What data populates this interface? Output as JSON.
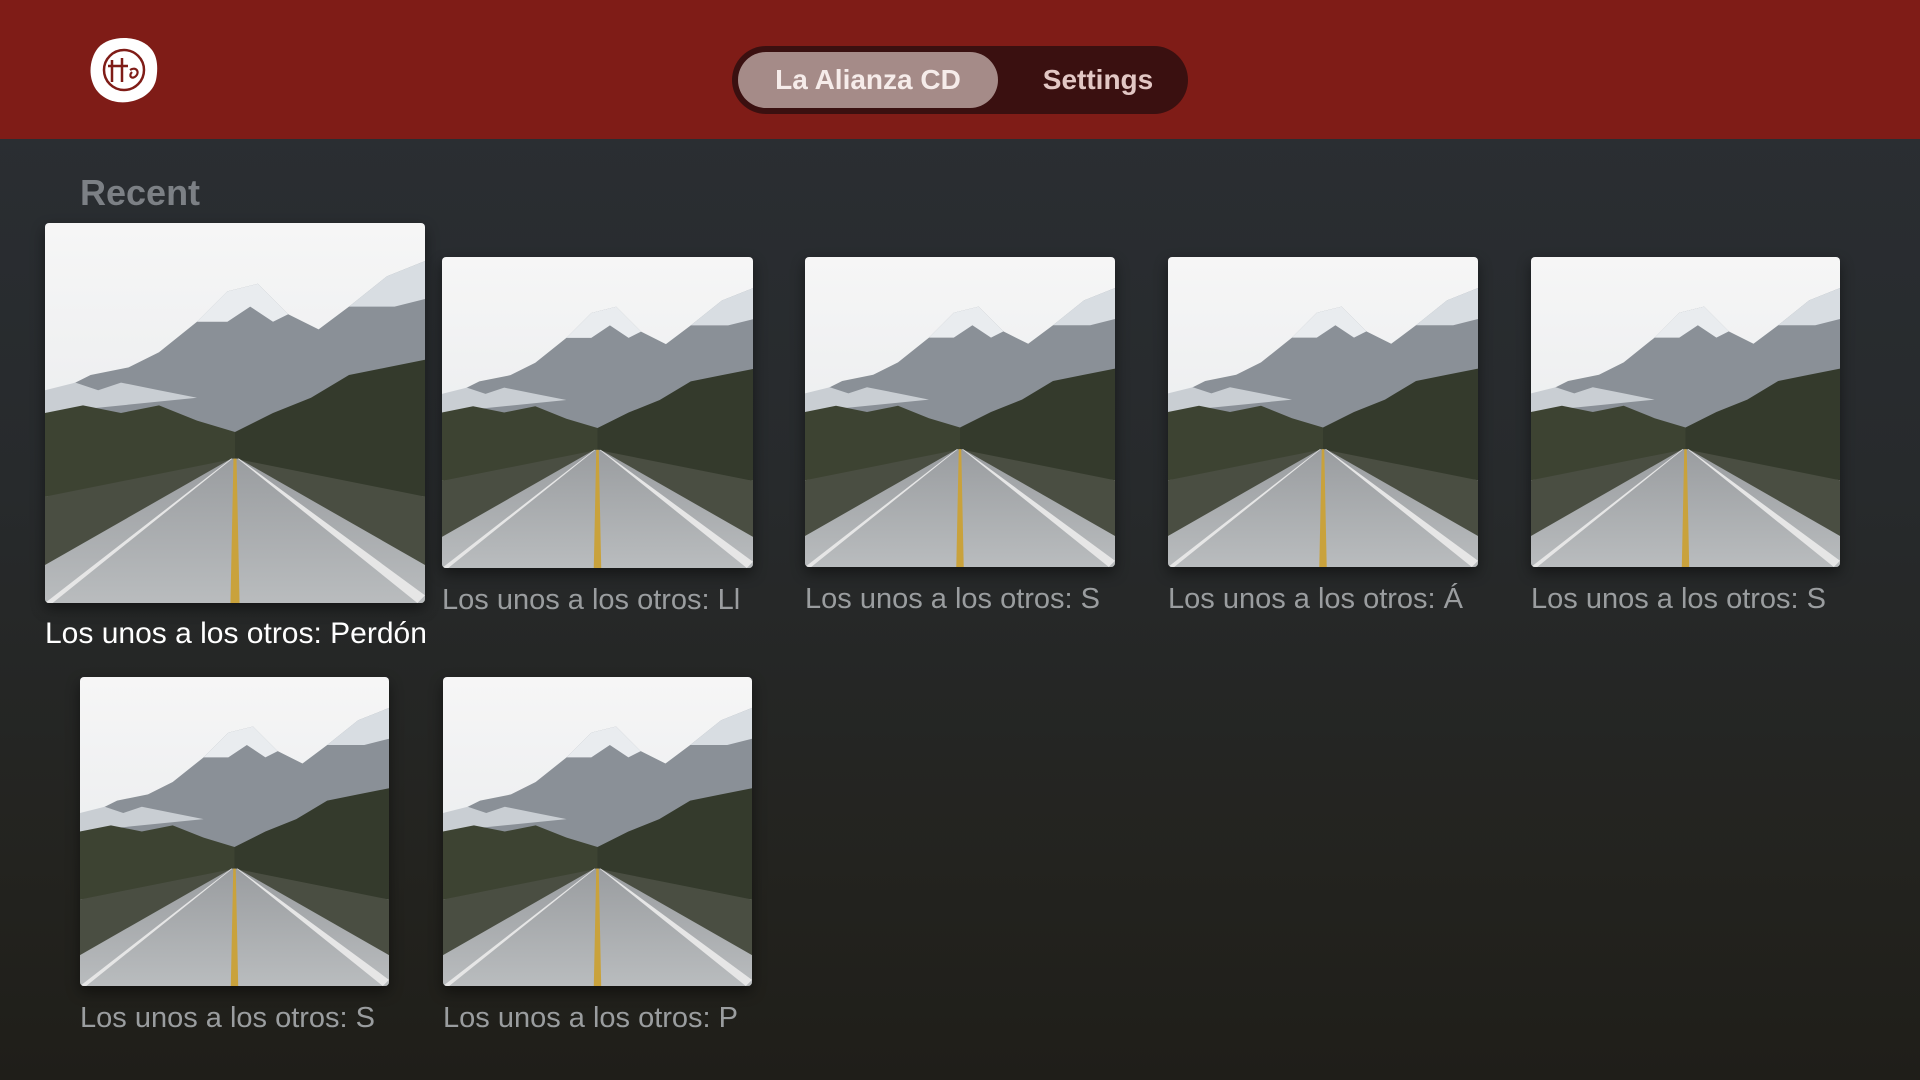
{
  "header": {
    "logo_icon": "church-logo-icon",
    "tabs": [
      {
        "label": "La Alianza CD",
        "selected": true
      },
      {
        "label": "Settings",
        "selected": false
      }
    ],
    "brand_color": "#7f1c17"
  },
  "recent": {
    "title": "Recent",
    "items": [
      {
        "caption": "Los unos a los otros: Perdón",
        "focused": true
      },
      {
        "caption": "Los unos a los otros: Ll"
      },
      {
        "caption": "Los unos a los otros: S"
      },
      {
        "caption": "Los unos a los otros: Á"
      },
      {
        "caption": "Los unos a los otros: S"
      },
      {
        "caption": "Los unos a los otros: S"
      },
      {
        "caption": "Los unos a los otros: P"
      }
    ]
  }
}
